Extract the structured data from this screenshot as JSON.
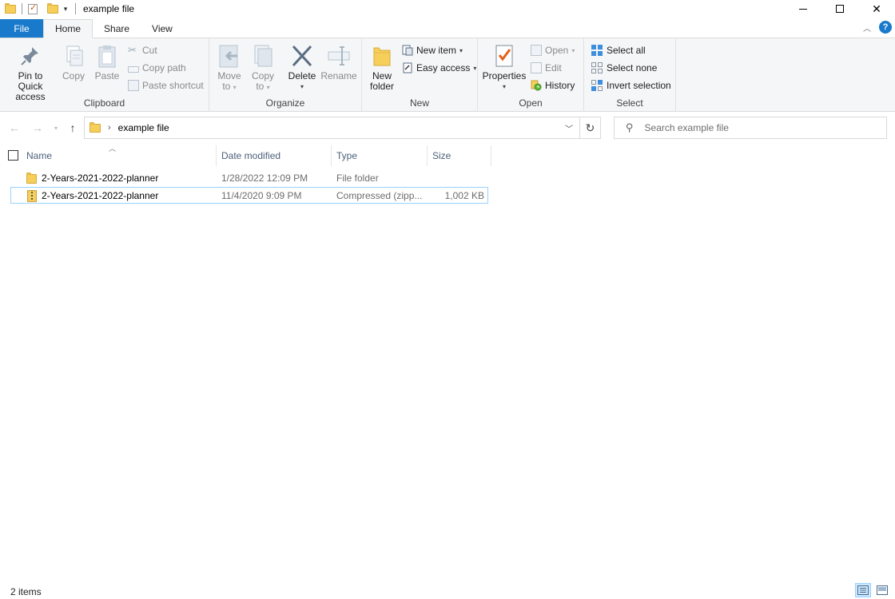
{
  "window": {
    "title": "example file"
  },
  "ribbon_tabs": [
    "File",
    "Home",
    "Share",
    "View"
  ],
  "clipboard": {
    "pin_label_1": "Pin to Quick",
    "pin_label_2": "access",
    "copy": "Copy",
    "paste": "Paste",
    "cut": "Cut",
    "copy_path": "Copy path",
    "paste_shortcut": "Paste shortcut",
    "group": "Clipboard"
  },
  "organize": {
    "move_1": "Move",
    "move_2": "to",
    "copy_1": "Copy",
    "copy_2": "to",
    "delete": "Delete",
    "rename": "Rename",
    "group": "Organize"
  },
  "new": {
    "folder_1": "New",
    "folder_2": "folder",
    "new_item": "New item",
    "easy_access": "Easy access",
    "group": "New"
  },
  "open": {
    "properties": "Properties",
    "open": "Open",
    "edit": "Edit",
    "history": "History",
    "group": "Open"
  },
  "select": {
    "select_all": "Select all",
    "select_none": "Select none",
    "invert": "Invert selection",
    "group": "Select"
  },
  "address": {
    "crumb": "example file",
    "search_placeholder": "Search example file"
  },
  "columns": [
    "Name",
    "Date modified",
    "Type",
    "Size"
  ],
  "files": [
    {
      "name": "2-Years-2021-2022-planner",
      "date": "1/28/2022 12:09 PM",
      "type": "File folder",
      "size": "",
      "icon": "folder-icon"
    },
    {
      "name": "2-Years-2021-2022-planner",
      "date": "11/4/2020 9:09 PM",
      "type": "Compressed (zipp...",
      "size": "1,002 KB",
      "icon": "zip-icon"
    }
  ],
  "status": {
    "count": "2 items"
  }
}
